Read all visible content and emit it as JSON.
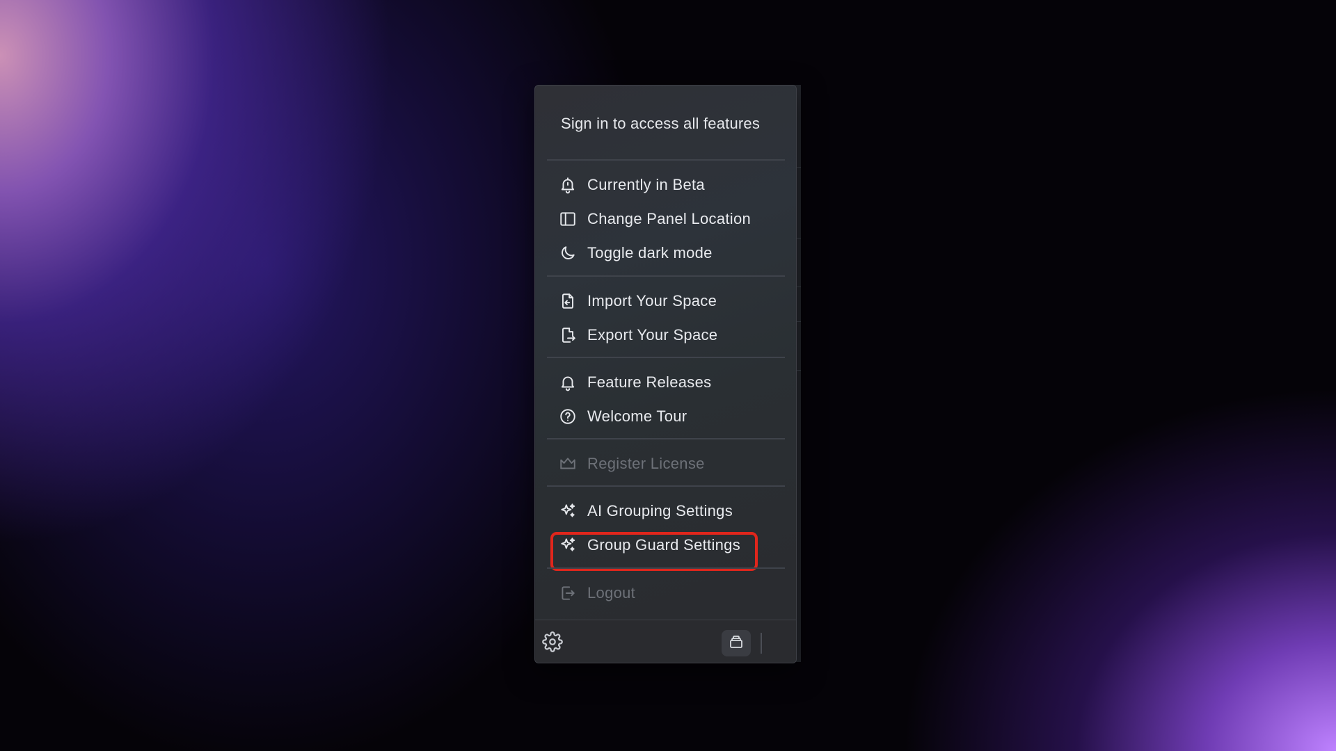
{
  "header": {
    "signin_text": "Sign in to access all features"
  },
  "menu": {
    "groups": [
      [
        {
          "label": "Currently in Beta",
          "icon": "bell-alert-icon",
          "enabled": true
        },
        {
          "label": "Change Panel Location",
          "icon": "panel-layout-icon",
          "enabled": true
        },
        {
          "label": "Toggle dark mode",
          "icon": "moon-icon",
          "enabled": true
        }
      ],
      [
        {
          "label": "Import Your Space",
          "icon": "file-import-icon",
          "enabled": true
        },
        {
          "label": "Export Your Space",
          "icon": "file-export-icon",
          "enabled": true
        }
      ],
      [
        {
          "label": "Feature Releases",
          "icon": "bell-icon",
          "enabled": true
        },
        {
          "label": "Welcome Tour",
          "icon": "question-circle-icon",
          "enabled": true
        }
      ],
      [
        {
          "label": "Register License",
          "icon": "crown-icon",
          "enabled": false
        }
      ],
      [
        {
          "label": "AI Grouping Settings",
          "icon": "sparkles-icon",
          "enabled": true
        },
        {
          "label": "Group Guard Settings",
          "icon": "sparkles-icon",
          "enabled": true,
          "highlighted": true
        }
      ],
      [
        {
          "label": "Logout",
          "icon": "logout-icon",
          "enabled": false
        }
      ]
    ]
  },
  "highlight": {
    "color": "#e0261c"
  },
  "footer": {
    "settings_icon": "gear-icon",
    "stack_icon": "stack-icon"
  },
  "background": {
    "accent_left": "#d698be",
    "accent_right": "#be82ff",
    "base": "#050308"
  }
}
